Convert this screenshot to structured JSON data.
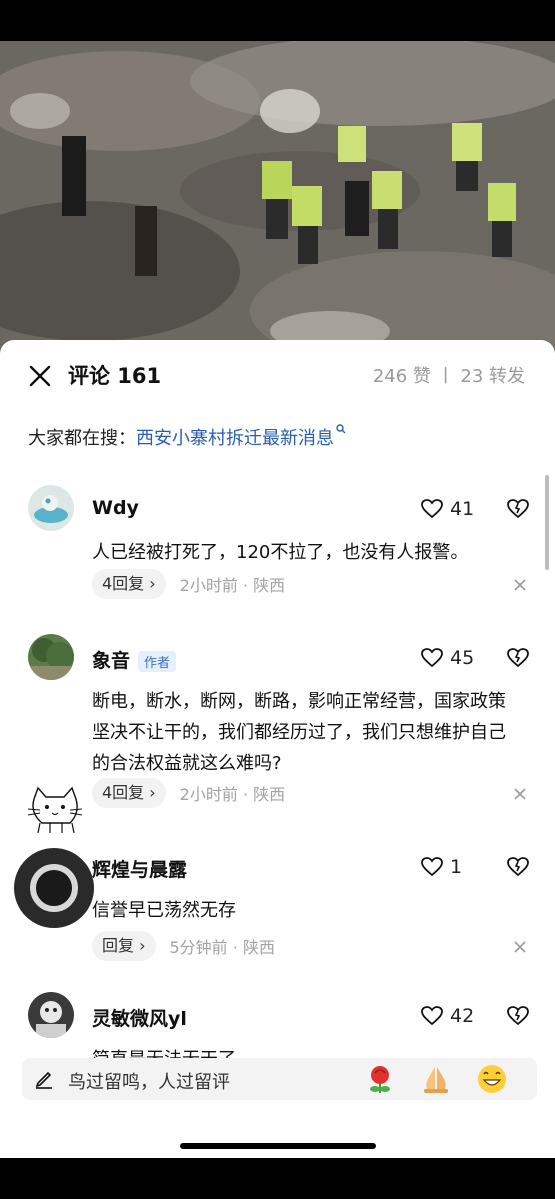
{
  "header": {
    "close_icon": "close-icon",
    "title": "评论 161",
    "stats": "246 赞 丨 23 转发"
  },
  "search": {
    "prefix": "大家都在搜：",
    "keyword": "西安小寨村拆迁最新消息",
    "icon": "search-icon",
    "accent": "#2a5db0"
  },
  "comments": [
    {
      "user": "Wdy",
      "badge": "",
      "likes": "41",
      "text": "人已经被打死了，120不拉了，也没有人报警。",
      "replies": "4回复 ›",
      "meta": "2小时前 · 陕西"
    },
    {
      "user": "象音",
      "badge": "作者",
      "likes": "45",
      "text": "断电，断水，断网，断路，影响正常经营，国家政策坚决不让干的，我们都经历过了，我们只想维护自己的合法权益就这么难吗?",
      "replies": "4回复 ›",
      "meta": "2小时前 · 陕西"
    },
    {
      "user": "辉煌与晨露",
      "badge": "",
      "likes": "1",
      "text": "信誉早已荡然无存",
      "replies": "回复 ›",
      "meta": "5分钟前 · 陕西"
    },
    {
      "user": "灵敏微风yl",
      "badge": "",
      "likes": "42",
      "text": "简直是无法无天了",
      "replies": "",
      "meta": ""
    }
  ],
  "input": {
    "placeholder": "鸟过留鸣，人过留评",
    "pen_icon": "pen-icon",
    "emojis": [
      "rose-emoji",
      "pray-emoji",
      "grin-emoji"
    ]
  }
}
